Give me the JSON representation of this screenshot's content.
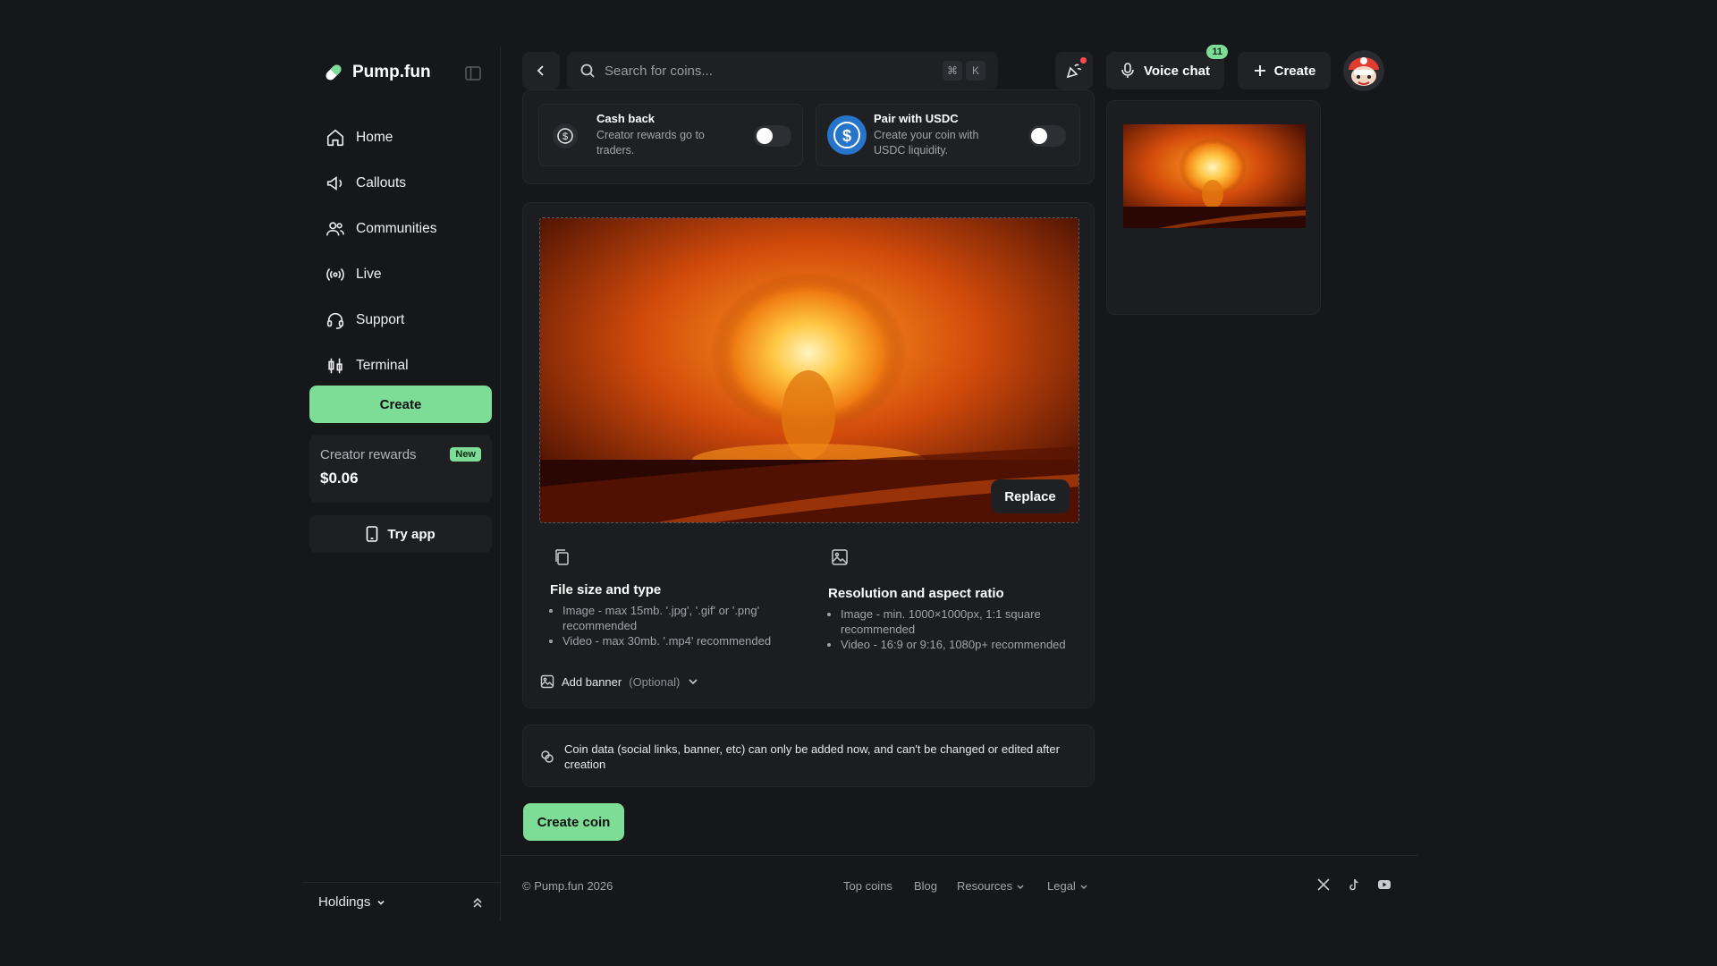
{
  "sidebar": {
    "brand": "Pump.fun",
    "nav": [
      {
        "label": "Home",
        "icon": "home-icon"
      },
      {
        "label": "Callouts",
        "icon": "megaphone-icon"
      },
      {
        "label": "Communities",
        "icon": "users-icon"
      },
      {
        "label": "Live",
        "icon": "broadcast-icon"
      },
      {
        "label": "Support",
        "icon": "headset-icon"
      },
      {
        "label": "Terminal",
        "icon": "candlestick-icon"
      }
    ],
    "create_label": "Create",
    "rewards_label": "Creator rewards",
    "rewards_badge": "New",
    "rewards_value": "$0.06",
    "try_app_label": "Try app",
    "holdings_label": "Holdings"
  },
  "header": {
    "search_placeholder": "Search for coins...",
    "shortcut_cmd": "⌘",
    "shortcut_key": "K",
    "voice_label": "Voice chat",
    "voice_count": "11",
    "create_label": "Create"
  },
  "options": {
    "cashback_title": "Cash back",
    "cashback_desc": "Creator rewards go to traders.",
    "usdc_title": "Pair with USDC",
    "usdc_desc": "Create your coin with USDC liquidity."
  },
  "upload": {
    "replace_label": "Replace",
    "file_title": "File size and type",
    "file_items": [
      "Image - max 15mb. '.jpg', '.gif' or '.png' recommended",
      "Video - max 30mb. '.mp4' recommended"
    ],
    "res_title": "Resolution and aspect ratio",
    "res_items": [
      "Image - min. 1000×1000px, 1:1 square recommended",
      "Video - 16:9 or 9:16, 1080p+ recommended"
    ],
    "banner_label": "Add banner",
    "banner_optional": "(Optional)"
  },
  "notice": "Coin data (social links, banner, etc) can only be added now, and can't be changed or edited after creation",
  "create_coin_label": "Create coin",
  "footer": {
    "copyright": "© Pump.fun 2026",
    "links": [
      "Top coins",
      "Blog",
      "Resources",
      "Legal"
    ]
  },
  "colors": {
    "accent": "#7ddc95",
    "background": "#16171b",
    "usdc": "#2775ca",
    "notification": "#ff4d4f"
  }
}
